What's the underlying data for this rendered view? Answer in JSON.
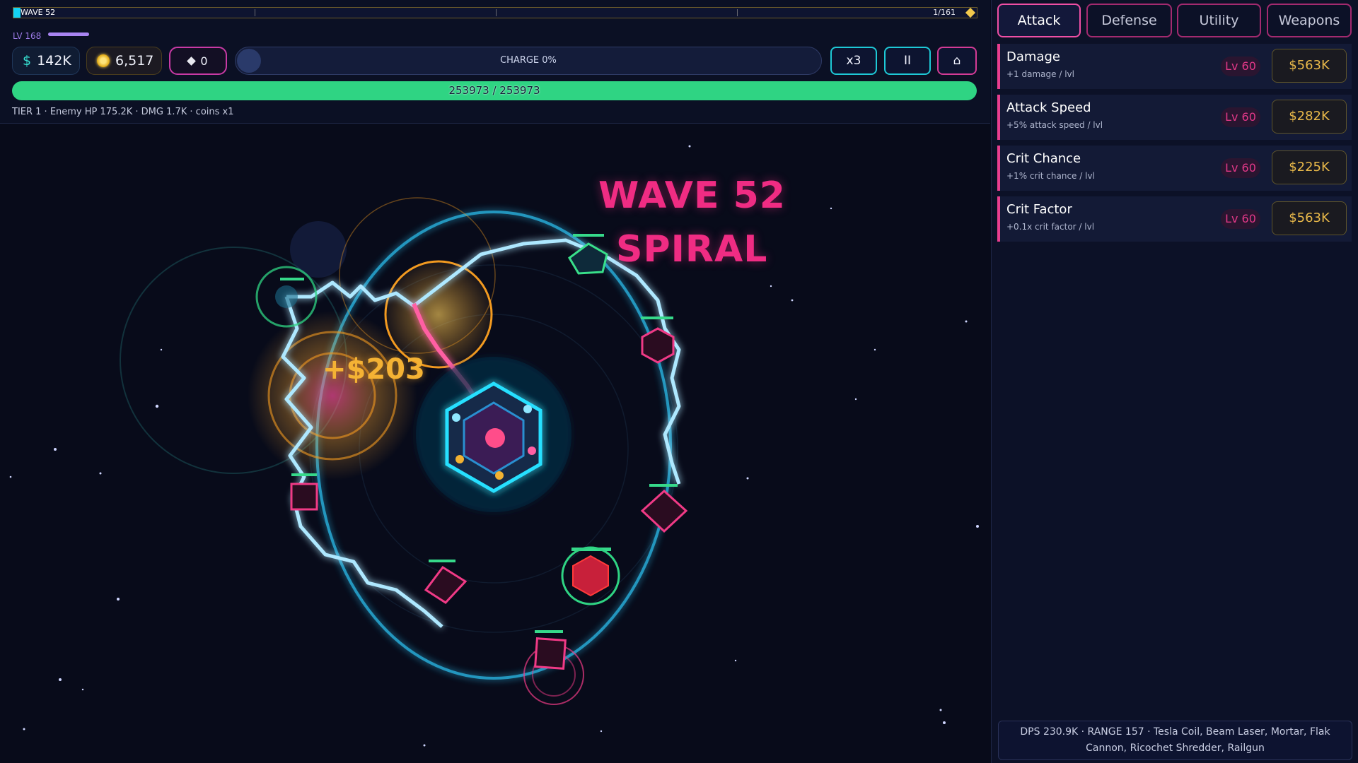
{
  "wave_bar": {
    "label": "WAVE 52",
    "count": "1/161"
  },
  "player": {
    "level_label": "LV 168"
  },
  "currency": {
    "money_symbol": "$",
    "money": "142K",
    "coins": "6,517",
    "gems": "0"
  },
  "charge": {
    "label": "CHARGE 0%",
    "progress": 0
  },
  "controls": {
    "speed": "x3",
    "pause_symbol": "II",
    "home_symbol": "⌂"
  },
  "base_hp": {
    "text": "253973 / 253973",
    "current": 253973,
    "max": 253973
  },
  "info_line": "TIER 1  ·  Enemy HP 175.2K · DMG 1.7K  ·  coins x1",
  "banner": {
    "title": "WAVE 52",
    "subtitle": "SPIRAL"
  },
  "popup": {
    "coin_gain": "+$203"
  },
  "tabs": [
    {
      "label": "Attack",
      "active": true
    },
    {
      "label": "Defense",
      "active": false
    },
    {
      "label": "Utility",
      "active": false
    },
    {
      "label": "Weapons",
      "active": false
    }
  ],
  "upgrades": [
    {
      "name": "Damage",
      "desc": "+1 damage / lvl",
      "level": "Lv 60",
      "cost": "$563K"
    },
    {
      "name": "Attack Speed",
      "desc": "+5% attack speed / lvl",
      "level": "Lv 60",
      "cost": "$282K"
    },
    {
      "name": "Crit Chance",
      "desc": "+1% crit chance / lvl",
      "level": "Lv 60",
      "cost": "$225K"
    },
    {
      "name": "Crit Factor",
      "desc": "+0.1x crit factor / lvl",
      "level": "Lv 60",
      "cost": "$563K"
    }
  ],
  "stats": {
    "line1": "DPS 230.9K   ·   RANGE 157   ·   Tesla Coil, Beam Laser, Mortar, Flak",
    "line2": "Cannon, Ricochet Shredder, Railgun"
  },
  "colors": {
    "accent_pink": "#f02c83",
    "accent_cyan": "#1ec9d6",
    "hp_green": "#2fd483",
    "gold": "#e9b94a"
  },
  "icons": [
    "money-icon",
    "coin-icon",
    "gem-icon",
    "pause-icon",
    "home-icon",
    "wave-end-gem-icon"
  ]
}
